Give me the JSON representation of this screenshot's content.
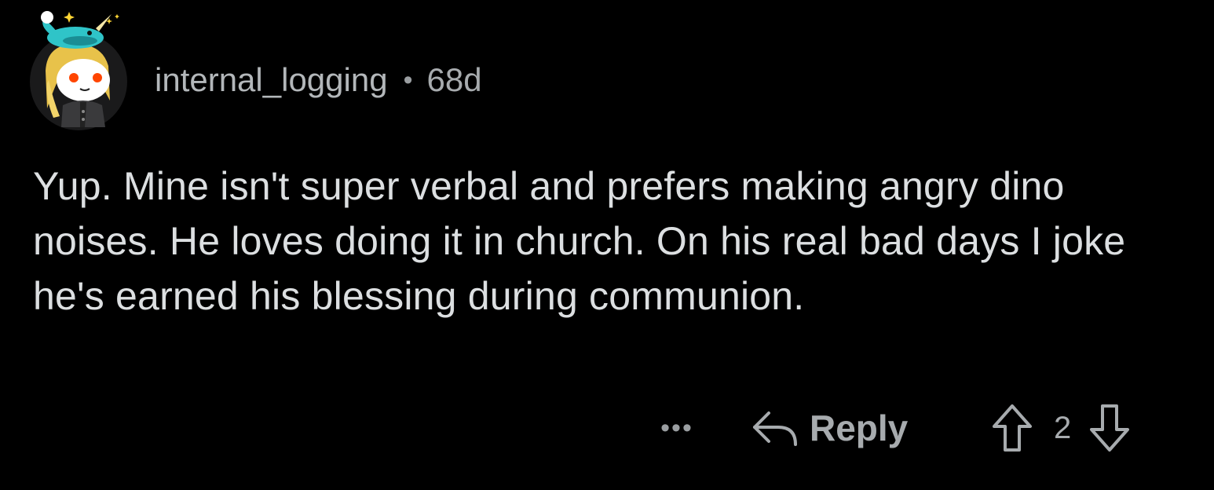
{
  "comment": {
    "author": "internal_logging",
    "separator": "•",
    "age": "68d",
    "body": "Yup. Mine isn't super verbal and prefers making angry dino noises. He loves doing it in church. On his real bad days I joke he's earned his blessing during communion."
  },
  "actions": {
    "more_label": "•••",
    "reply_label": "Reply",
    "score": "2"
  },
  "icons": {
    "avatar": "snoo-avatar-narwhal-hat",
    "reply": "reply-arrow-icon",
    "upvote": "upvote-arrow-icon",
    "downvote": "downvote-arrow-icon"
  },
  "colors": {
    "background": "#000000",
    "body_text": "#dcdfe1",
    "meta_text": "#b3b7ba",
    "icon_stroke": "#a7abae"
  }
}
